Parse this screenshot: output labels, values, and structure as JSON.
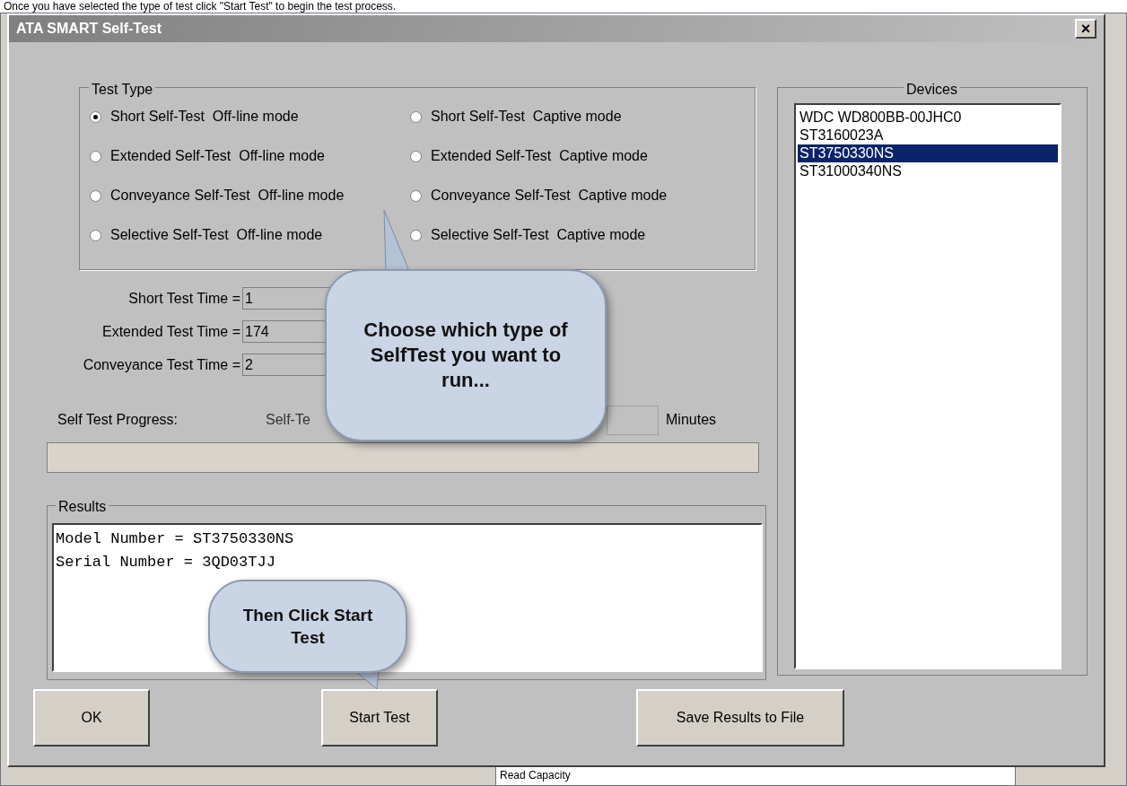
{
  "caption": "Once you have selected the type of test click \"Start Test\" to begin the test process.",
  "window": {
    "title": "ATA SMART Self-Test",
    "close": "×"
  },
  "test_type": {
    "label": "Test Type",
    "options": [
      {
        "label": "Short Self-Test  Off-line mode",
        "selected": true
      },
      {
        "label": "Short Self-Test  Captive mode",
        "selected": false
      },
      {
        "label": "Extended Self-Test  Off-line mode",
        "selected": false
      },
      {
        "label": "Extended Self-Test  Captive mode",
        "selected": false
      },
      {
        "label": "Conveyance Self-Test  Off-line mode",
        "selected": false
      },
      {
        "label": "Conveyance Self-Test  Captive mode",
        "selected": false
      },
      {
        "label": "Selective Self-Test  Off-line mode",
        "selected": false
      },
      {
        "label": "Selective Self-Test  Captive mode",
        "selected": false
      }
    ]
  },
  "times": [
    {
      "label": "Short Test Time =",
      "value": "1"
    },
    {
      "label": "Extended Test Time =",
      "value": "174"
    },
    {
      "label": "Conveyance Test Time =",
      "value": "2"
    }
  ],
  "progress": {
    "label": "Self Test Progress:",
    "running_text": "Self-Te",
    "minutes_unit": "Minutes",
    "level": 0
  },
  "results": {
    "label": "Results",
    "lines": [
      "Model Number = ST3750330NS",
      "Serial Number = 3QD03TJJ"
    ]
  },
  "devices": {
    "label": "Devices",
    "items": [
      {
        "label": "WDC WD800BB-00JHC0",
        "selected": false
      },
      {
        "label": "ST3160023A",
        "selected": false
      },
      {
        "label": "ST3750330NS",
        "selected": true
      },
      {
        "label": "ST31000340NS",
        "selected": false
      }
    ]
  },
  "buttons": [
    "OK",
    "Start Test",
    "Save Results to File"
  ],
  "background_text": "Read Capacity",
  "callouts": [
    {
      "text": "Choose which type of SelfTest you want to run..."
    },
    {
      "text": "Then Click Start Test"
    }
  ]
}
